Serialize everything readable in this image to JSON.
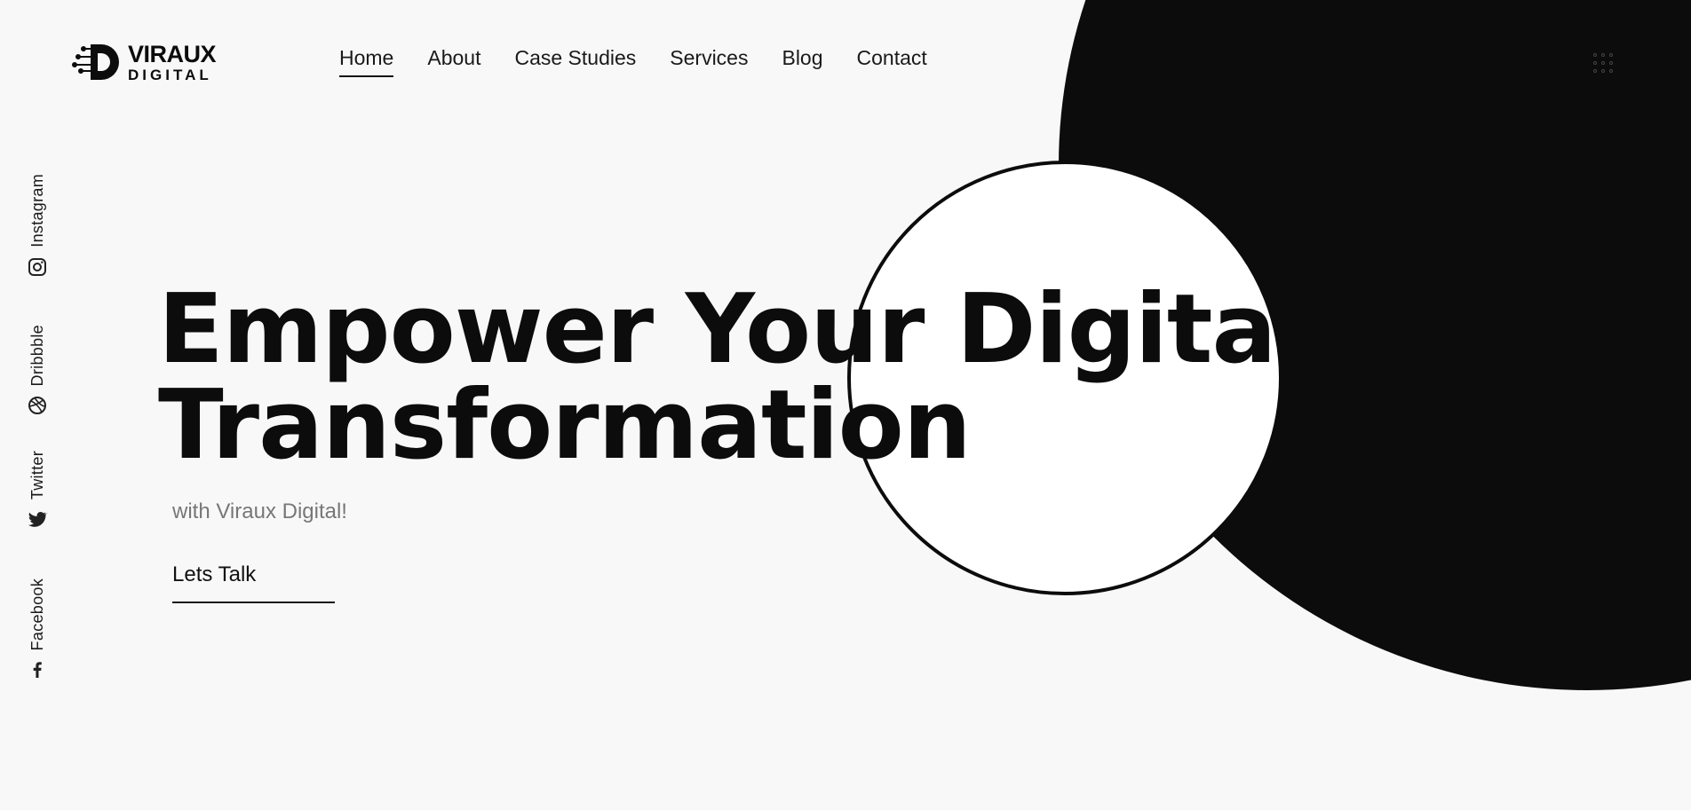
{
  "brand": {
    "name_line1": "VIRAUX",
    "name_line2": "DIGITAL",
    "logo_icon": "viraux-d-logo-icon",
    "primary_color": "#0c0c0c",
    "background_color": "#f8f8f8"
  },
  "nav": {
    "items": [
      {
        "label": "Home",
        "active": true
      },
      {
        "label": "About",
        "active": false
      },
      {
        "label": "Case Studies",
        "active": false
      },
      {
        "label": "Services",
        "active": false
      },
      {
        "label": "Blog",
        "active": false
      },
      {
        "label": "Contact",
        "active": false
      }
    ],
    "menu_icon": "grid-dots-icon"
  },
  "social": [
    {
      "label": "Instagram",
      "icon": "instagram-icon"
    },
    {
      "label": "Dribbble",
      "icon": "dribbble-icon"
    },
    {
      "label": "Twitter",
      "icon": "twitter-icon"
    },
    {
      "label": "Facebook",
      "icon": "facebook-icon"
    }
  ],
  "hero": {
    "title_line1": "Empower Your Digital",
    "title_line2": "Transformation",
    "subtitle": "with Viraux Digital!",
    "cta_label": "Lets Talk"
  }
}
